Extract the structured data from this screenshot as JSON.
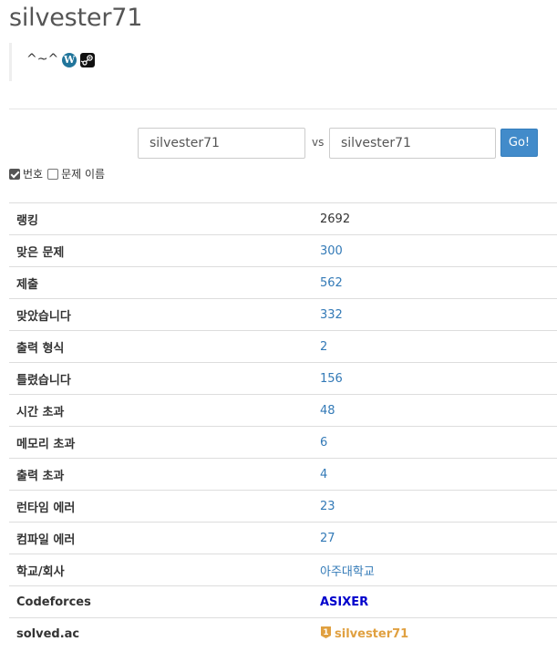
{
  "profile": {
    "username": "silvester71",
    "status_message": "^~^",
    "status_icons": [
      "wordpress-icon",
      "steam-icon"
    ]
  },
  "compare": {
    "left_value": "silvester71",
    "right_value": "silvester71",
    "vs_label": "vs",
    "go_label": "Go!"
  },
  "options": {
    "number_label": "번호",
    "number_checked": true,
    "problem_name_label": "문제 이름",
    "problem_name_checked": false
  },
  "stats": [
    {
      "label": "랭킹",
      "value": "2692",
      "link": false
    },
    {
      "label": "맞은 문제",
      "value": "300",
      "link": true
    },
    {
      "label": "제출",
      "value": "562",
      "link": true
    },
    {
      "label": "맞았습니다",
      "value": "332",
      "link": true
    },
    {
      "label": "출력 형식",
      "value": "2",
      "link": true
    },
    {
      "label": "틀렸습니다",
      "value": "156",
      "link": true
    },
    {
      "label": "시간 초과",
      "value": "48",
      "link": true
    },
    {
      "label": "메모리 초과",
      "value": "6",
      "link": true
    },
    {
      "label": "출력 초과",
      "value": "4",
      "link": true
    },
    {
      "label": "런타임 에러",
      "value": "23",
      "link": true
    },
    {
      "label": "컴파일 에러",
      "value": "27",
      "link": true
    },
    {
      "label": "학교/회사",
      "value": "아주대학교",
      "link": true
    }
  ],
  "codeforces": {
    "label": "Codeforces",
    "value": "ASIXER",
    "color": "#0000cc"
  },
  "solvedac": {
    "label": "solved.ac",
    "value": "silvester71",
    "tier": "1",
    "tier_color": "#e0a040"
  },
  "colors": {
    "link": "#337ab7",
    "go_button": "#428bca"
  }
}
